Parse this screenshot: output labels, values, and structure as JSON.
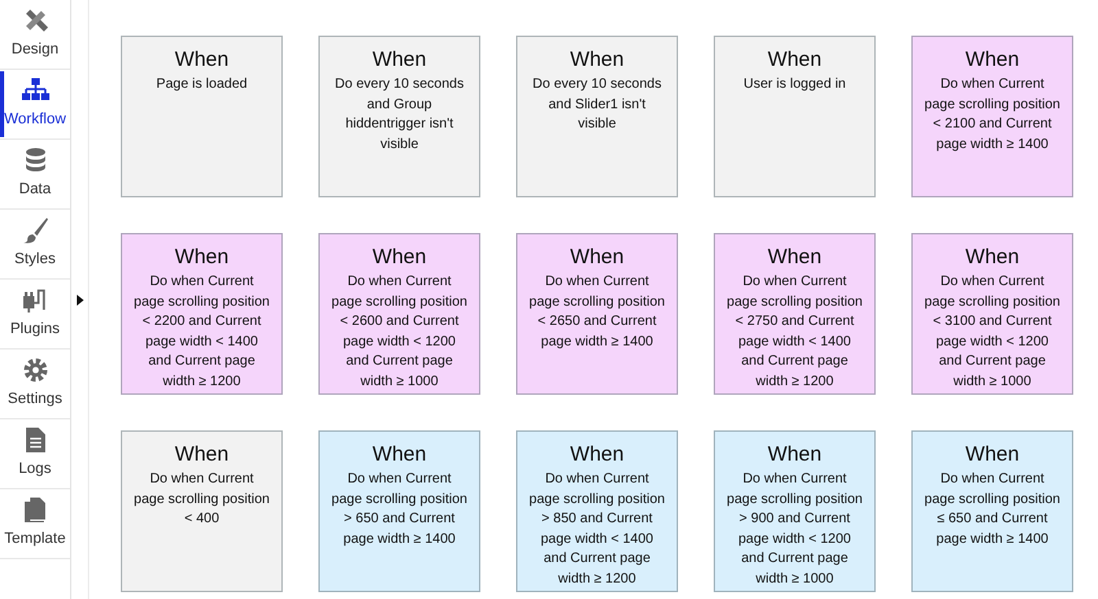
{
  "sidebar": {
    "items": [
      {
        "label": "Design",
        "selected": false
      },
      {
        "label": "Workflow",
        "selected": true
      },
      {
        "label": "Data",
        "selected": false
      },
      {
        "label": "Styles",
        "selected": false
      },
      {
        "label": "Plugins",
        "selected": false
      },
      {
        "label": "Settings",
        "selected": false
      },
      {
        "label": "Logs",
        "selected": false
      },
      {
        "label": "Template",
        "selected": false
      }
    ]
  },
  "events": [
    {
      "title": "When",
      "condition": "Page is loaded",
      "color": "#f2f2f2"
    },
    {
      "title": "When",
      "condition": "Do every 10 seconds and Group hiddentrigger isn't visible",
      "color": "#f2f2f2"
    },
    {
      "title": "When",
      "condition": "Do every 10 seconds and Slider1 isn't visible",
      "color": "#f2f2f2"
    },
    {
      "title": "When",
      "condition": "User is logged in",
      "color": "#f2f2f2"
    },
    {
      "title": "When",
      "condition": "Do when Current page scrolling position < 2100 and Current page width ≥ 1400",
      "color": "#f5d5fb"
    },
    {
      "title": "When",
      "condition": "Do when Current page scrolling position < 2200 and Current page width < 1400 and Current page width ≥ 1200",
      "color": "#f5d5fb"
    },
    {
      "title": "When",
      "condition": "Do when Current page scrolling position < 2600 and Current page width < 1200 and Current page width ≥ 1000",
      "color": "#f5d5fb"
    },
    {
      "title": "When",
      "condition": "Do when Current page scrolling position < 2650 and Current page width ≥ 1400",
      "color": "#f5d5fb"
    },
    {
      "title": "When",
      "condition": "Do when Current page scrolling position < 2750 and Current page width < 1400 and Current page width ≥ 1200",
      "color": "#f5d5fb"
    },
    {
      "title": "When",
      "condition": "Do when Current page scrolling position < 3100 and Current page width < 1200 and Current page width ≥ 1000",
      "color": "#f5d5fb"
    },
    {
      "title": "When",
      "condition": "Do when Current page scrolling position < 400",
      "color": "#f2f2f2"
    },
    {
      "title": "When",
      "condition": "Do when Current page scrolling position > 650 and Current page width ≥ 1400",
      "color": "#d9effc"
    },
    {
      "title": "When",
      "condition": "Do when Current page scrolling position > 850 and Current page width < 1400 and Current page width ≥ 1200",
      "color": "#d9effc"
    },
    {
      "title": "When",
      "condition": "Do when Current page scrolling position > 900 and Current page width < 1200 and Current page width ≥ 1000",
      "color": "#d9effc"
    },
    {
      "title": "When",
      "condition": "Do when Current page scrolling position ≤ 650 and Current page width ≥ 1400",
      "color": "#d9effc"
    }
  ]
}
